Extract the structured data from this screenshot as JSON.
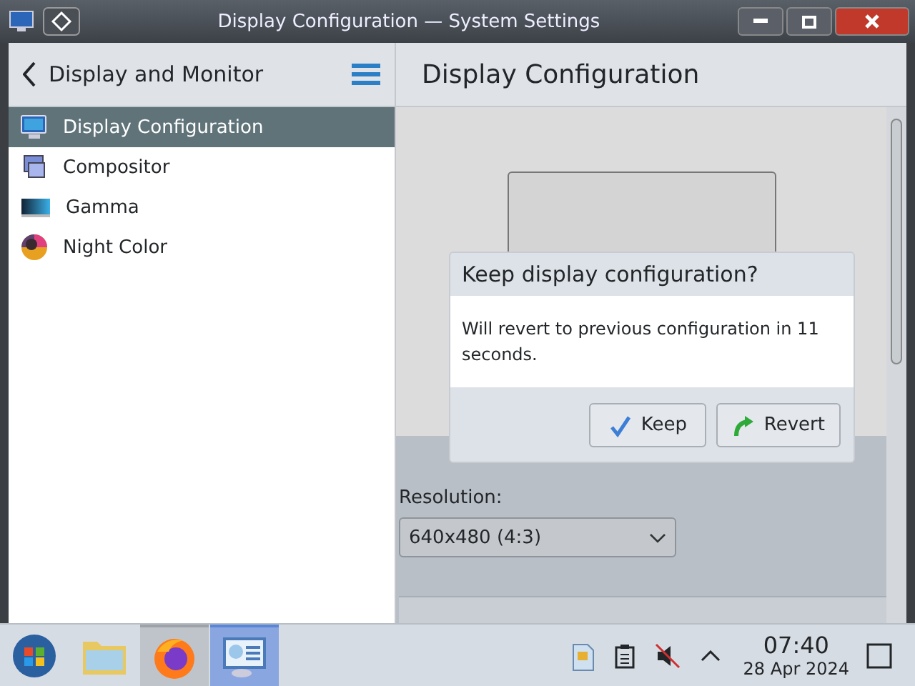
{
  "window": {
    "title": "Display Configuration — System Settings"
  },
  "sidebar": {
    "title": "Display and Monitor",
    "items": [
      {
        "label": "Display Configuration",
        "selected": true
      },
      {
        "label": "Compositor",
        "selected": false
      },
      {
        "label": "Gamma",
        "selected": false
      },
      {
        "label": "Night Color",
        "selected": false
      }
    ]
  },
  "page": {
    "title": "Display Configuration",
    "resolution_label": "Resolution:",
    "resolution_value": "640x480 (4:3)"
  },
  "dialog": {
    "title": "Keep display configuration?",
    "message": "Will revert to previous configuration in 11 seconds.",
    "buttons": [
      {
        "label": "Keep",
        "kind": "keep"
      },
      {
        "label": "Revert",
        "kind": "revert"
      }
    ]
  },
  "taskbar": {
    "apps": [
      {
        "kind": "start",
        "selected": false,
        "running": false
      },
      {
        "kind": "files",
        "selected": false,
        "running": false
      },
      {
        "kind": "browser",
        "selected": false,
        "running": true
      },
      {
        "kind": "settings",
        "selected": true,
        "running": true
      }
    ],
    "clock": {
      "time": "07:40",
      "date": "28 Apr 2024"
    }
  }
}
